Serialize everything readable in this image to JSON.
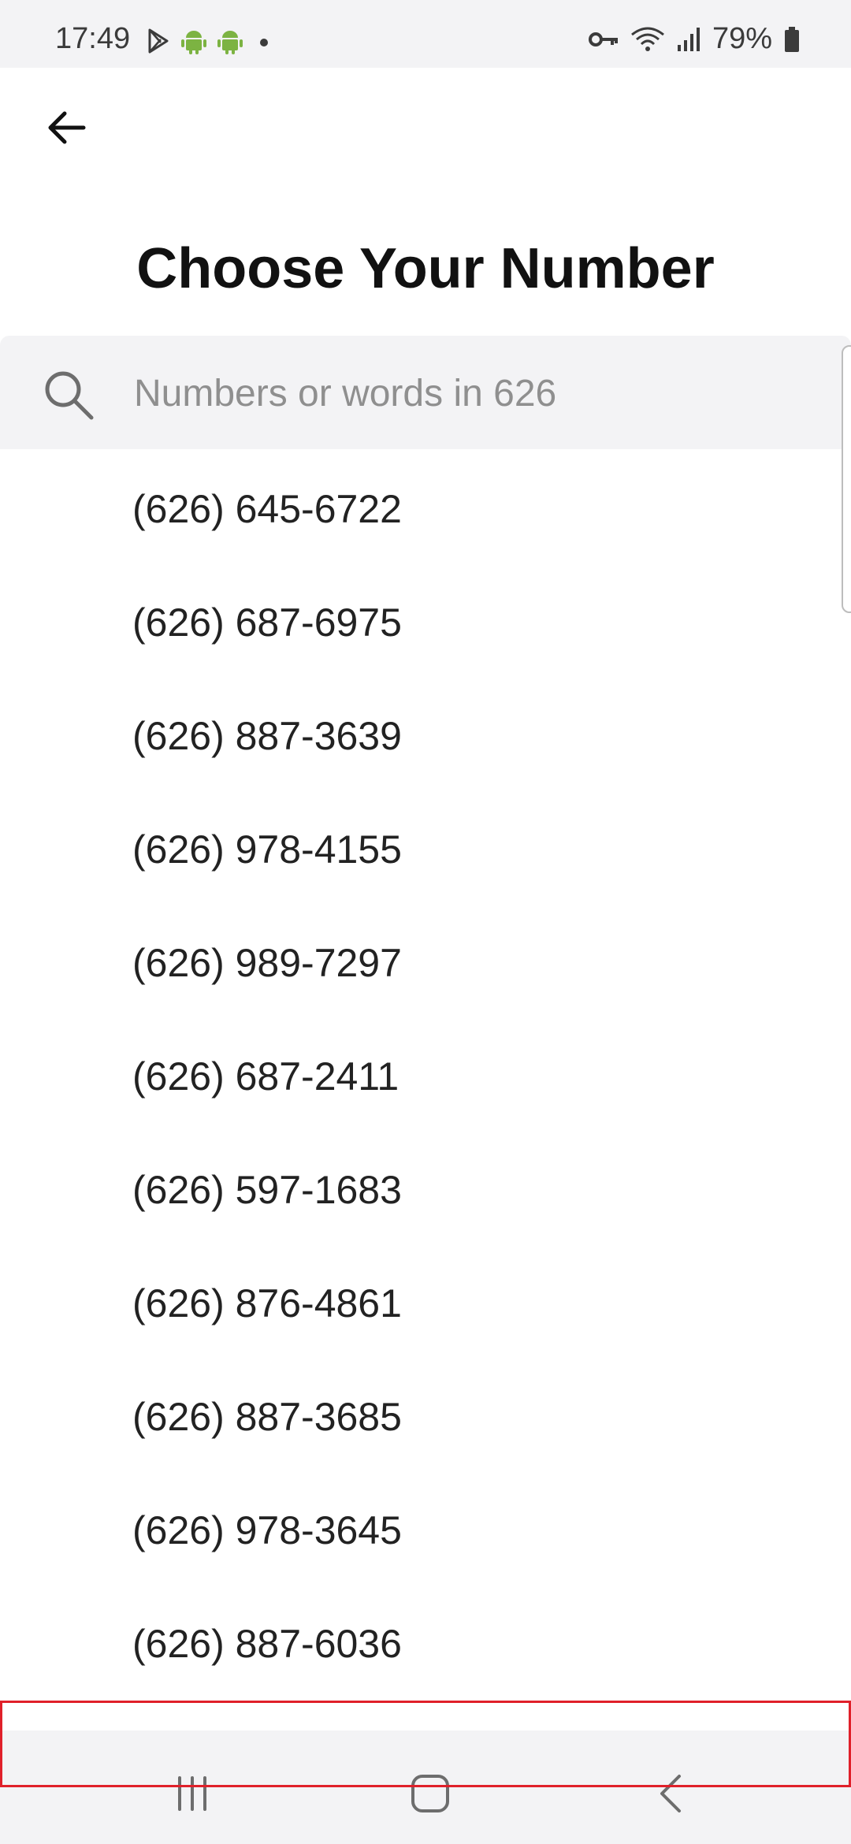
{
  "status_bar": {
    "time": "17:49",
    "left_icons": [
      "play-store-icon",
      "android-icon",
      "android-icon",
      "dot-icon"
    ],
    "right_icons": [
      "vpn-key-icon",
      "wifi-icon",
      "signal-icon",
      "battery-icon"
    ],
    "battery": "79%"
  },
  "header": {
    "back_icon": "arrow-left-icon",
    "title": "Choose Your Number"
  },
  "search": {
    "icon": "search-icon",
    "placeholder": "Numbers or words in 626",
    "value": ""
  },
  "numbers": [
    "(626) 645-6722",
    "(626) 687-6975",
    "(626) 887-3639",
    "(626) 978-4155",
    "(626) 989-7297",
    "(626) 687-2411",
    "(626) 597-1683",
    "(626) 876-4861",
    "(626) 887-3685",
    "(626) 978-3645",
    "(626) 887-6036"
  ],
  "nav_bar": {
    "buttons": [
      "recents-icon",
      "home-icon",
      "back-icon"
    ]
  },
  "colors": {
    "status_bg": "#f3f3f5",
    "search_bg": "#f3f3f5",
    "highlight": "#e0202a",
    "android_green": "#7cb342"
  }
}
